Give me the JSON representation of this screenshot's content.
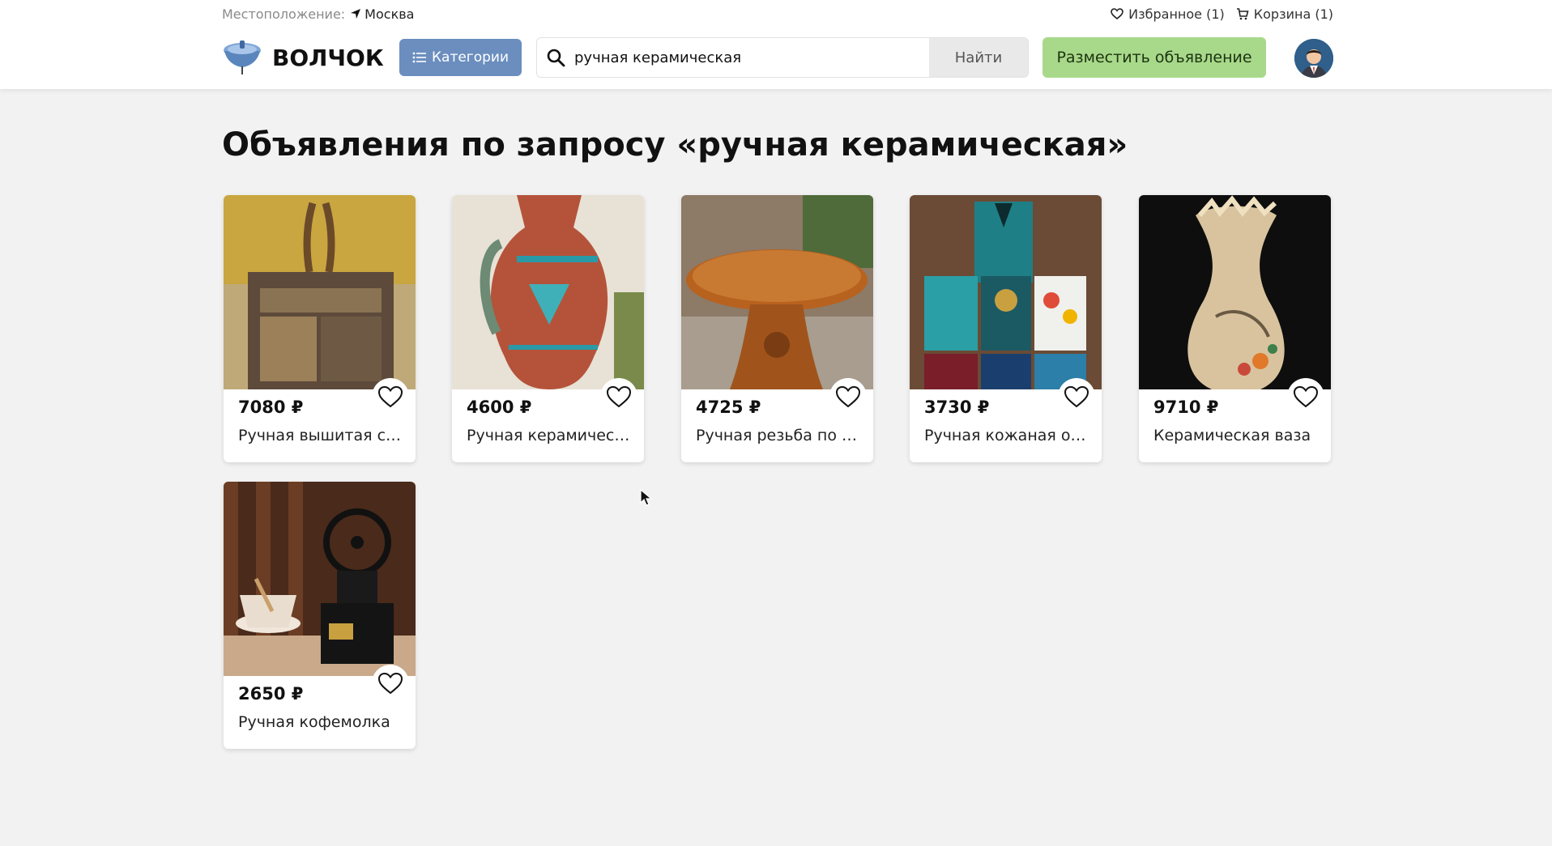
{
  "topbar": {
    "location_label": "Местоположение:",
    "city": "Москва",
    "favorites": "Избранное (1)",
    "cart": "Корзина (1)"
  },
  "header": {
    "logo_text": "ВОЛЧОК",
    "categories_label": "Категории",
    "search_value": "ручная керамическая",
    "search_button": "Найти",
    "post_ad_button": "Разместить объявление"
  },
  "page": {
    "title": "Объявления по запросу «ручная керамическая»"
  },
  "listings": [
    {
      "price": "7080 ₽",
      "name": "Ручная вышитая сумка"
    },
    {
      "price": "4600 ₽",
      "name": "Ручная керамическая ваза"
    },
    {
      "price": "4725 ₽",
      "name": "Ручная резьба по дереву"
    },
    {
      "price": "3730 ₽",
      "name": "Ручная кожаная обложка"
    },
    {
      "price": "9710 ₽",
      "name": "Керамическая ваза"
    },
    {
      "price": "2650 ₽",
      "name": "Ручная кофемолка"
    }
  ],
  "colors": {
    "accent_blue": "#6b8ebf",
    "post_green": "#a8d98a",
    "background": "#f2f2f2"
  }
}
